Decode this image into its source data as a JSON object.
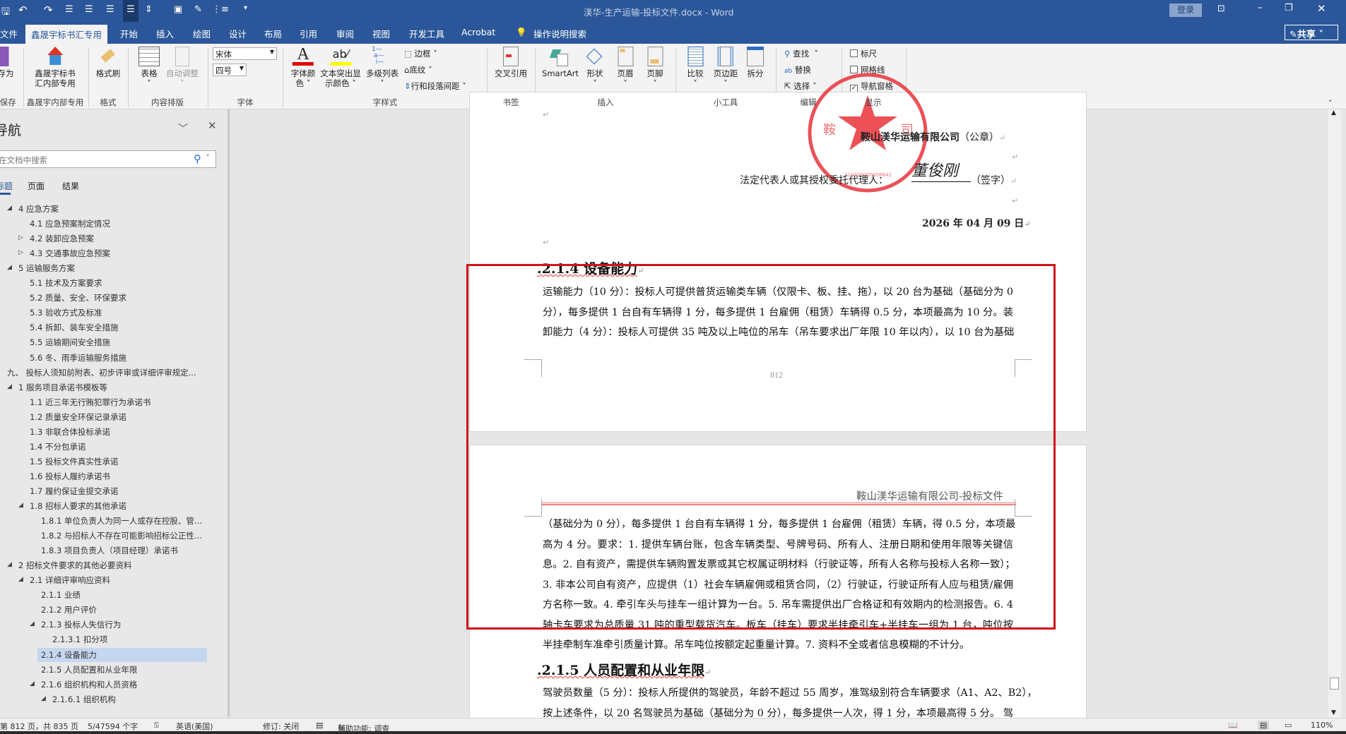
{
  "window": {
    "title": "渼华-生产运输-投标文件.docx  -  Word",
    "login": "登录",
    "share": "共享"
  },
  "tabs": [
    "文件",
    "鑫晟宇标书汇专用",
    "开始",
    "插入",
    "绘图",
    "设计",
    "布局",
    "引用",
    "审阅",
    "视图",
    "开发工具",
    "Acrobat"
  ],
  "tell_me": "操作说明搜索",
  "ribbon": {
    "save_as": "存为",
    "save_group": "F保存",
    "xsy_btn": [
      "鑫晟宇标书",
      "汇内部专用"
    ],
    "xsy_group": "鑫晟宇内部专用",
    "format_painter": "格式刷",
    "format_group": "格式",
    "table": "表格",
    "autofit": "自动调整",
    "layout_group": "内容排版",
    "font_name": "宋体",
    "font_size": "四号",
    "font_group": "字体",
    "font_color": [
      "字体颜",
      "色"
    ],
    "highlight": [
      "文本突出显",
      "示颜色"
    ],
    "multilevel": "多级列表",
    "border": "边框",
    "shading": "底纹",
    "spacing": "行和段落间距",
    "style_group": "字样式",
    "crossref": "交叉引用",
    "bookmark_group": "书签",
    "smartart": "SmartArt",
    "shape": "形状",
    "header": "页眉",
    "footer": "页脚",
    "insert_group": "插入",
    "compare": "比较",
    "margins": "页边距",
    "split": "拆分",
    "tools_group": "小工具",
    "find": "查找",
    "replace": "替换",
    "select": "选择",
    "edit_group": "编辑",
    "ruler": "标尺",
    "gridlines": "网格线",
    "navpane": "导航窗格",
    "show_group": "显示",
    "colors": {
      "font": "#e00000",
      "highlight": "#ffff00"
    }
  },
  "nav": {
    "title": "导航",
    "search_placeholder": "在文档中搜索",
    "tabs": [
      "标题",
      "页面",
      "结果"
    ],
    "items": [
      {
        "t": "4 应急方案",
        "lv": 1,
        "ex": "open"
      },
      {
        "t": "4.1 应急预案制定情况",
        "lv": 2,
        "ex": ""
      },
      {
        "t": "4.2 装卸应急预案",
        "lv": 2,
        "ex": "closed"
      },
      {
        "t": "4.3 交通事故应急预案",
        "lv": 2,
        "ex": "closed"
      },
      {
        "t": "5 运输服务方案",
        "lv": 1,
        "ex": "open"
      },
      {
        "t": "5.1 技术及方案要求",
        "lv": 2,
        "ex": ""
      },
      {
        "t": "5.2 质量、安全、环保要求",
        "lv": 2,
        "ex": ""
      },
      {
        "t": "5.3 验收方式及标准",
        "lv": 2,
        "ex": ""
      },
      {
        "t": "5.4 拆卸、装车安全措施",
        "lv": 2,
        "ex": ""
      },
      {
        "t": "5.5 运输期间安全措施",
        "lv": 2,
        "ex": ""
      },
      {
        "t": "5.6 冬、雨季运输服务措施",
        "lv": 2,
        "ex": ""
      },
      {
        "t": "九、 投标人须知前附表、初步评审或详细评审规定...",
        "lv": 0,
        "ex": ""
      },
      {
        "t": "1 服务项目承诺书模板等",
        "lv": 1,
        "ex": "open"
      },
      {
        "t": "1.1 近三年无行贿犯罪行为承诺书",
        "lv": 2,
        "ex": ""
      },
      {
        "t": "1.2 质量安全环保记录承诺",
        "lv": 2,
        "ex": ""
      },
      {
        "t": "1.3 非联合体投标承诺",
        "lv": 2,
        "ex": ""
      },
      {
        "t": "1.4 不分包承诺",
        "lv": 2,
        "ex": ""
      },
      {
        "t": "1.5 投标文件真实性承诺",
        "lv": 2,
        "ex": ""
      },
      {
        "t": "1.6 投标人履约承诺书",
        "lv": 2,
        "ex": ""
      },
      {
        "t": "1.7 履约保证金提交承诺",
        "lv": 2,
        "ex": ""
      },
      {
        "t": "1.8 招标人要求的其他承诺",
        "lv": 2,
        "ex": "open"
      },
      {
        "t": "1.8.1 单位负责人为同一人或存在控股、管...",
        "lv": 3,
        "ex": ""
      },
      {
        "t": "1.8.2 与招标人不存在可能影响招标公正性...",
        "lv": 3,
        "ex": ""
      },
      {
        "t": "1.8.3 项目负责人（项目经理）承诺书",
        "lv": 3,
        "ex": ""
      },
      {
        "t": "2 招标文件要求的其他必要资料",
        "lv": 1,
        "ex": "open"
      },
      {
        "t": "2.1 详细评审响应资料",
        "lv": 2,
        "ex": "open"
      },
      {
        "t": "2.1.1 业绩",
        "lv": 3,
        "ex": ""
      },
      {
        "t": "2.1.2 用户评价",
        "lv": 3,
        "ex": ""
      },
      {
        "t": "2.1.3 投标人失信行为",
        "lv": 3,
        "ex": "open"
      },
      {
        "t": "2.1.3.1 扣分项",
        "lv": 4,
        "ex": ""
      },
      {
        "t": "2.1.4 设备能力",
        "lv": 3,
        "ex": "",
        "sel": true
      },
      {
        "t": "2.1.5 人员配置和从业年限",
        "lv": 3,
        "ex": ""
      },
      {
        "t": "2.1.6 组织机构和人员资格",
        "lv": 3,
        "ex": "open"
      },
      {
        "t": "2.1.6.1 组织机构",
        "lv": 4,
        "ex": "open"
      }
    ]
  },
  "doc": {
    "company_seal_line": "鞍山渼华运输有限公司",
    "seal_suffix": "（公章）",
    "rep_label": "法定代表人或其授权委托代理人：",
    "signature": "董俊刚",
    "sign_suffix": "（签字）",
    "date": "2026 年 04 月 09 日",
    "seal_text": "鞍山渼华运输有限公司",
    "h214": ".2.1.4  设备能力",
    "p1": [
      "运输能力（10 分）：投标人可提供普货运输类车辆（仅限卡、板、挂、拖），以 20 台为基础（基础分为 0",
      "分），每多提供 1 台自有车辆得 1 分，每多提供 1 台雇佣（租赁）车辆得 0.5 分，本项最高为 10 分。装",
      "卸能力（4 分）：投标人可提供 35 吨及以上吨位的吊车（吊车要求出厂年限 10 年以内），以 10 台为基础"
    ],
    "page_number": "812",
    "running_header": "鞍山渼华运输有限公司-投标文件",
    "p2": [
      "（基础分为 0 分），每多提供 1 台自有车辆得 1 分，每多提供 1 台雇佣（租赁）车辆，得 0.5 分，本项最",
      "高为 4 分。要求：1. 提供车辆台账，包含车辆类型、号牌号码、所有人、注册日期和使用年限等关键信",
      "息。2. 自有资产，需提供车辆购置发票或其它权属证明材料（行驶证等，所有人名称与投标人名称一致）；",
      "3. 非本公司自有资产，应提供（1）社会车辆雇佣或租赁合同，（2）行驶证，行驶证所有人应与租赁/雇佣",
      "方名称一致。4. 牵引车头与挂车一组计算为一台。5. 吊车需提供出厂合格证和有效期内的检测报告。6. 4",
      "轴卡车要求为总质量 31 吨的重型载货汽车。板车（挂车）要求半挂牵引车+半挂车一组为 1 台，吨位按",
      "半挂牵制车准牵引质量计算。吊车吨位按额定起重量计算。7. 资料不全或者信息模糊的不计分。"
    ],
    "h215": ".2.1.5  人员配置和从业年限",
    "p3": [
      "驾驶员数量（5 分）：投标人所提供的驾驶员，年龄不超过 55 周岁，准驾级别符合车辆要求（A1、A2、B2），",
      "按上述条件，以 20 名驾驶员为基础（基础分为 0 分），每多提供一人次，得 1 分，本项最高得 5 分。 驾"
    ],
    "highlight_color": "#d0121b"
  },
  "status": {
    "page": "第 812 页，共 835 页",
    "words": "5/47594 个字",
    "lang": "英语(美国)",
    "track": "修订: 关闭",
    "a11y": "辅助功能: 调查",
    "zoom": "110%"
  }
}
